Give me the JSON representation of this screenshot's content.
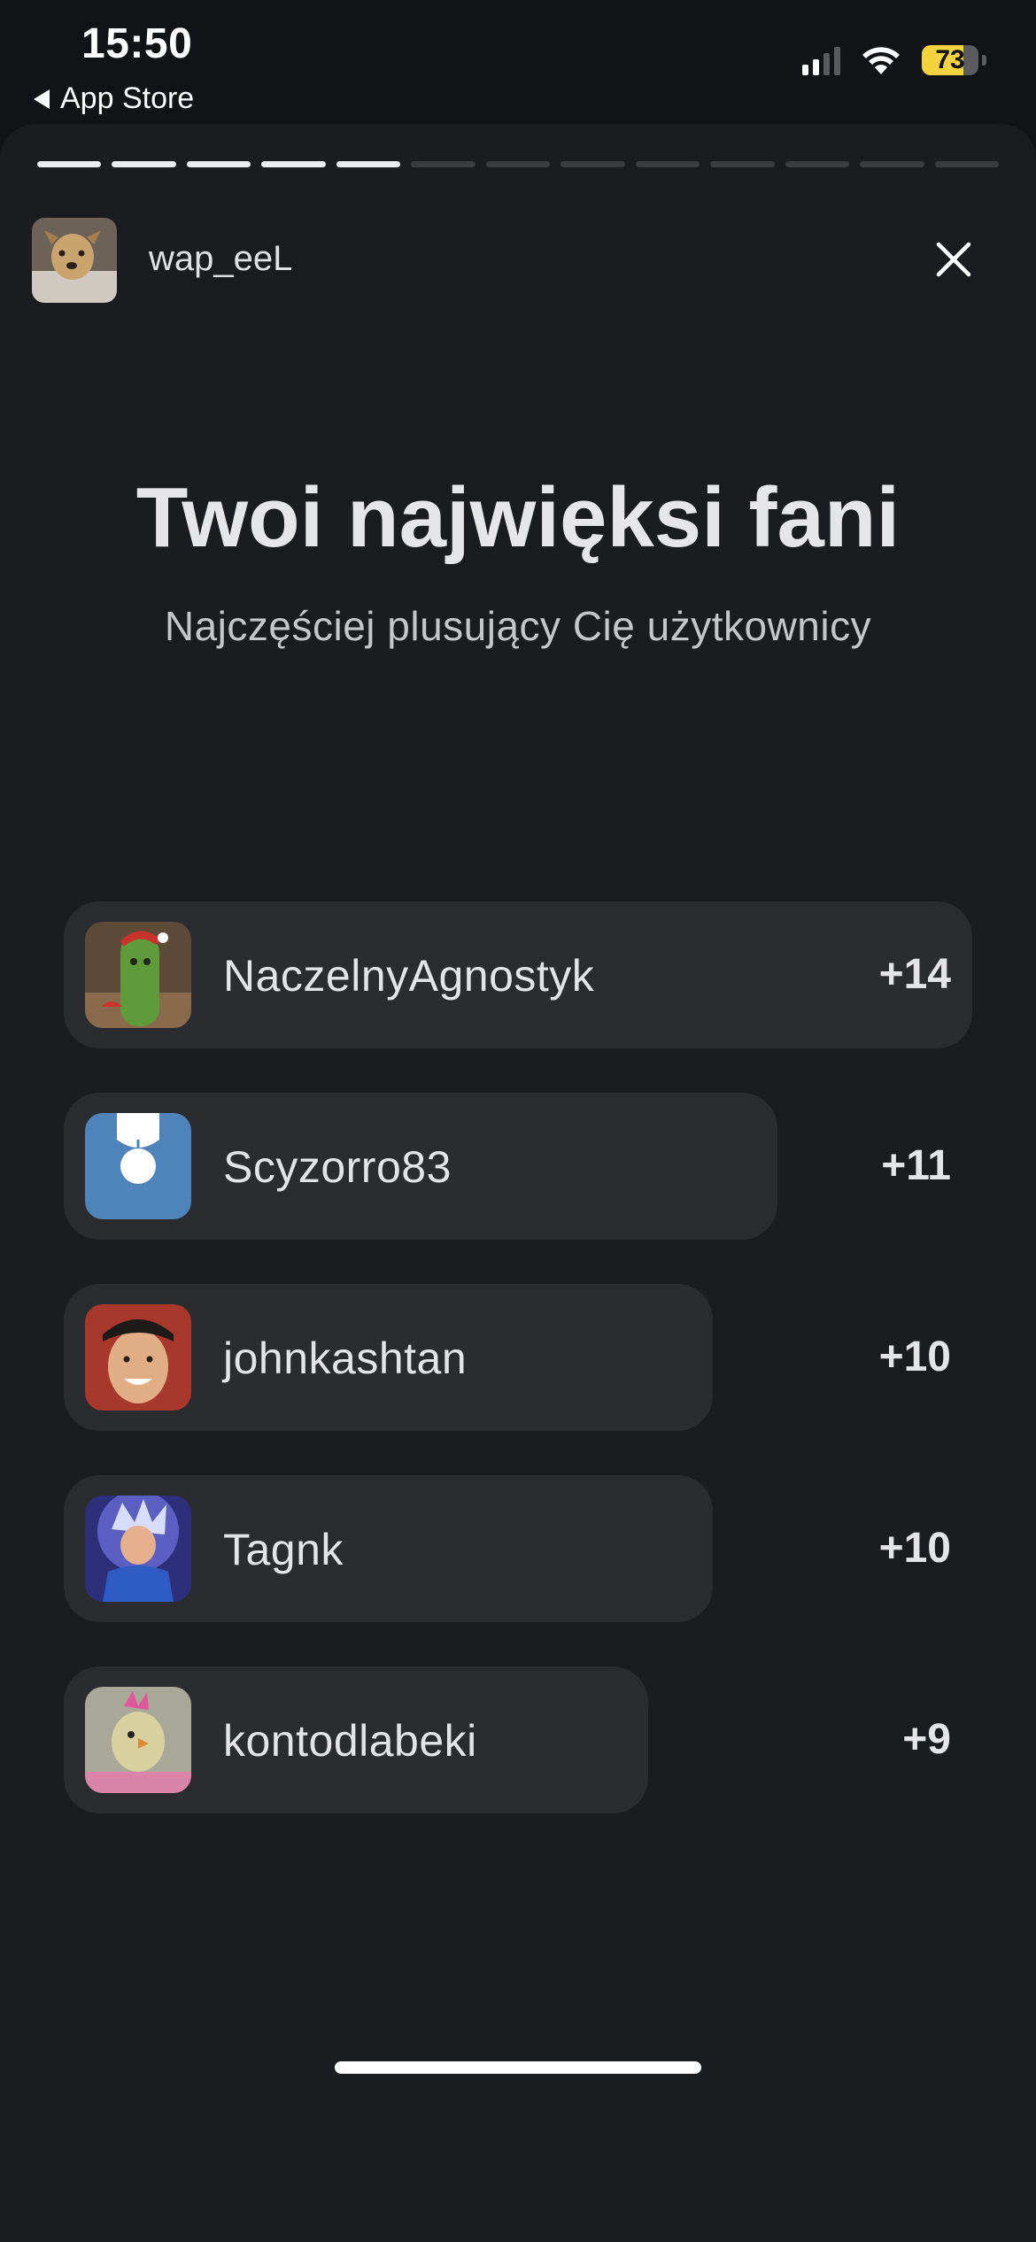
{
  "status_bar": {
    "time": "15:50",
    "back_label": "App Store",
    "battery_level": "73",
    "battery_fraction": 0.73
  },
  "story": {
    "progress_total_segments": 13,
    "progress_active_segments": 5,
    "username": "wap_eeL",
    "close_icon": "close-icon"
  },
  "content": {
    "title": "Twoi najwięksi fani",
    "subtitle": "Najczęściej plusujący Cię użytkownicy"
  },
  "fans": [
    {
      "name": "NaczelnyAgnostyk",
      "score": "+14",
      "value": 14
    },
    {
      "name": "Scyzorro83",
      "score": "+11",
      "value": 11
    },
    {
      "name": "johnkashtan",
      "score": "+10",
      "value": 10
    },
    {
      "name": "Tagnk",
      "score": "+10",
      "value": 10
    },
    {
      "name": "kontodlabeki",
      "score": "+9",
      "value": 9
    }
  ],
  "colors": {
    "background": "#121316",
    "sheet": "#1b1c1f",
    "row": "#2b2c30",
    "battery": "#f4d33f",
    "progress_active": "#ededf0",
    "progress_inactive": "#3b3c40"
  }
}
